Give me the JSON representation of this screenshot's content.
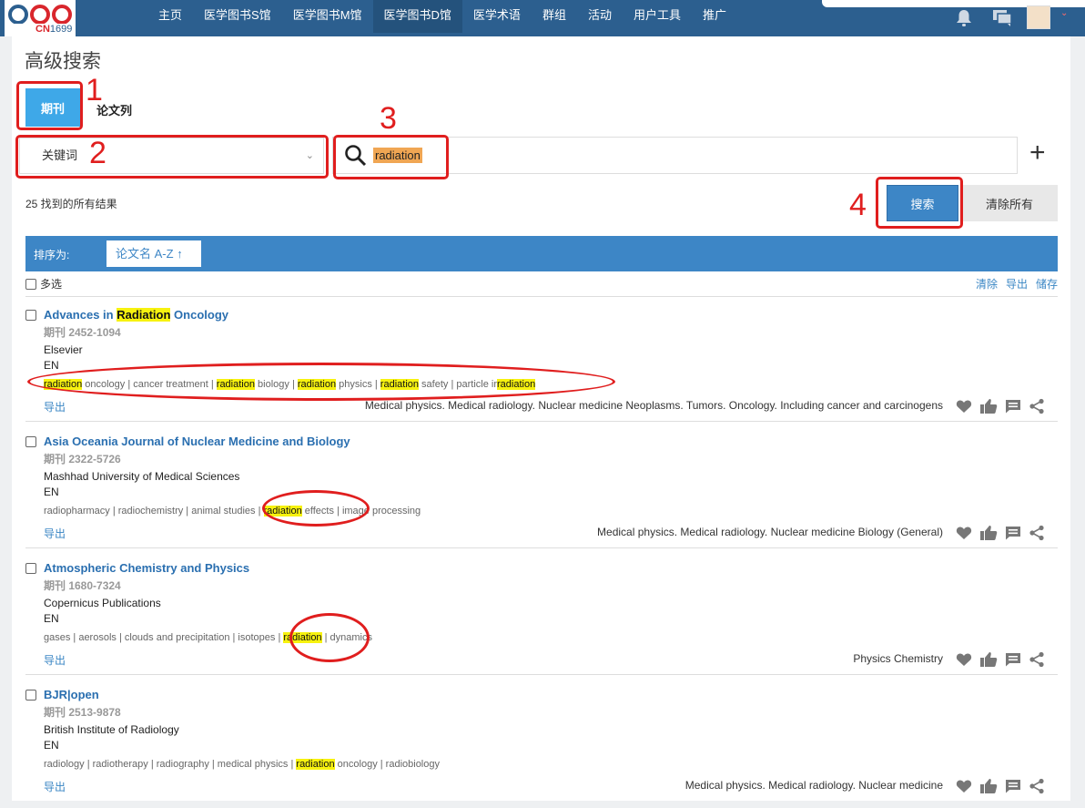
{
  "brand": {
    "logo_text": "CN",
    "logo_num": "1699"
  },
  "nav": [
    "主页",
    "医学图书S馆",
    "医学图书M馆",
    "医学图书D馆",
    "医学术语",
    "群组",
    "活动",
    "用户工具",
    "推广"
  ],
  "page_title": "高级搜索",
  "tabs": {
    "journal": "期刊",
    "paper": "论文列"
  },
  "filter": {
    "field": "关键词",
    "query": "radiation"
  },
  "result_count": "25 找到的所有结果",
  "buttons": {
    "search": "搜索",
    "clear_all": "清除所有"
  },
  "sort": {
    "label": "排序为:",
    "value": "论文名 A-Z"
  },
  "multi_select": "多选",
  "list_actions": [
    "清除",
    "导出",
    "储存"
  ],
  "annotations": [
    "1",
    "2",
    "3",
    "4"
  ],
  "records": [
    {
      "title_pre": "Advances in ",
      "title_hl": "Radiation",
      "title_post": " Oncology",
      "issn": "期刊 2452-1094",
      "publisher": "Elsevier",
      "lang": "EN",
      "kw": [
        "radiation|hl",
        " oncology | cancer treatment | ",
        "radiation|hl",
        " biology | ",
        "radiation|hl",
        " physics | ",
        "radiation|hl",
        " safety | particle ir",
        "radiation|hl"
      ],
      "export": "导出",
      "subjects": "Medical physics. Medical radiology. Nuclear medicine  Neoplasms. Tumors. Oncology. Including cancer and carcinogens"
    },
    {
      "title_pre": "Asia Oceania Journal of Nuclear Medicine and Biology",
      "title_hl": "",
      "title_post": "",
      "issn": "期刊 2322-5726",
      "publisher": "Mashhad University of Medical Sciences",
      "lang": "EN",
      "kw": [
        "radiopharmacy | radiochemistry | animal studies | ",
        "radiation|hl",
        " effects | image processing"
      ],
      "export": "导出",
      "subjects": "Medical physics. Medical radiology. Nuclear medicine  Biology (General)"
    },
    {
      "title_pre": "Atmospheric Chemistry and Physics",
      "title_hl": "",
      "title_post": "",
      "issn": "期刊 1680-7324",
      "publisher": "Copernicus Publications",
      "lang": "EN",
      "kw": [
        "gases | aerosols | clouds and precipitation | isotopes | ",
        "radiation|hl",
        " | dynamics"
      ],
      "export": "导出",
      "subjects": "Physics  Chemistry"
    },
    {
      "title_pre": "BJR|open",
      "title_hl": "",
      "title_post": "",
      "issn": "期刊 2513-9878",
      "publisher": "British Institute of Radiology",
      "lang": "EN",
      "kw": [
        "radiology | radiotherapy | radiography | medical physics | ",
        "radiation|hl",
        " oncology | radiobiology"
      ],
      "export": "导出",
      "subjects": "Medical physics. Medical radiology. Nuclear medicine"
    }
  ],
  "icon_names": [
    "heart-icon",
    "thumbs-up-icon",
    "comment-icon",
    "share-icon"
  ],
  "colors": {
    "topbar": "#2c5f8f",
    "accent": "#3d86c6",
    "highlight": "#f7f20f",
    "annotation": "#e01e1e"
  }
}
